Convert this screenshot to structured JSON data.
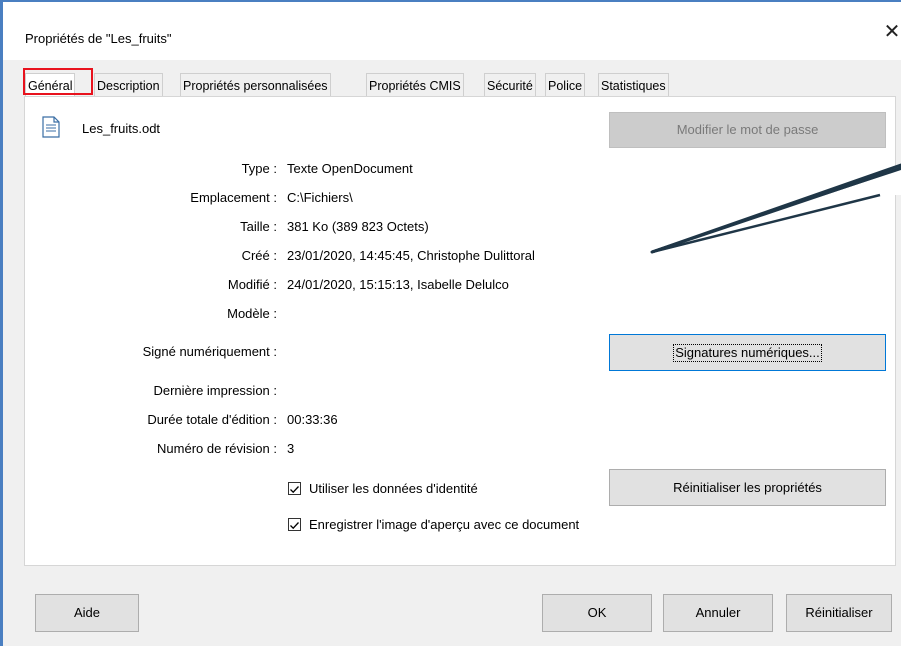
{
  "window": {
    "title": "Propriétés de \"Les_fruits\"",
    "close_glyph": "✕",
    "accent": "#4a7fc1"
  },
  "tabs": [
    {
      "label": "Général"
    },
    {
      "label": "Description"
    },
    {
      "label": "Propriétés personnalisées"
    },
    {
      "label": "Propriétés CMIS"
    },
    {
      "label": "Sécurité"
    },
    {
      "label": "Police"
    },
    {
      "label": "Statistiques"
    }
  ],
  "general": {
    "filename": "Les_fruits.odt",
    "change_password_button": "Modifier le mot de passe",
    "type_label": "Type :",
    "type_value": "Texte OpenDocument",
    "location_label": "Emplacement :",
    "location_value": "C:\\Fichiers\\",
    "size_label": "Taille :",
    "size_value": "381 Ko (389 823 Octets)",
    "created_label": "Créé :",
    "created_value": "23/01/2020, 14:45:45,  Christophe Dulittoral",
    "modified_label": "Modifié :",
    "modified_value": "24/01/2020, 15:15:13,  Isabelle Delulco",
    "template_label": "Modèle :",
    "signed_label": "Signé numériquement :",
    "signatures_button": "Signatures numériques...",
    "last_print_label": "Dernière impression :",
    "edit_time_label": "Durée totale d'édition :",
    "edit_time_value": "00:33:36",
    "revision_label": "Numéro de révision :",
    "revision_value": "3",
    "use_identity_label": "Utiliser les données d'identité",
    "reset_props_button": "Réinitialiser les propriétés",
    "save_thumbnail_label": "Enregistrer l'image d'aperçu avec ce document"
  },
  "footer": {
    "help": "Aide",
    "ok": "OK",
    "cancel": "Annuler",
    "reset": "Réinitialiser"
  }
}
